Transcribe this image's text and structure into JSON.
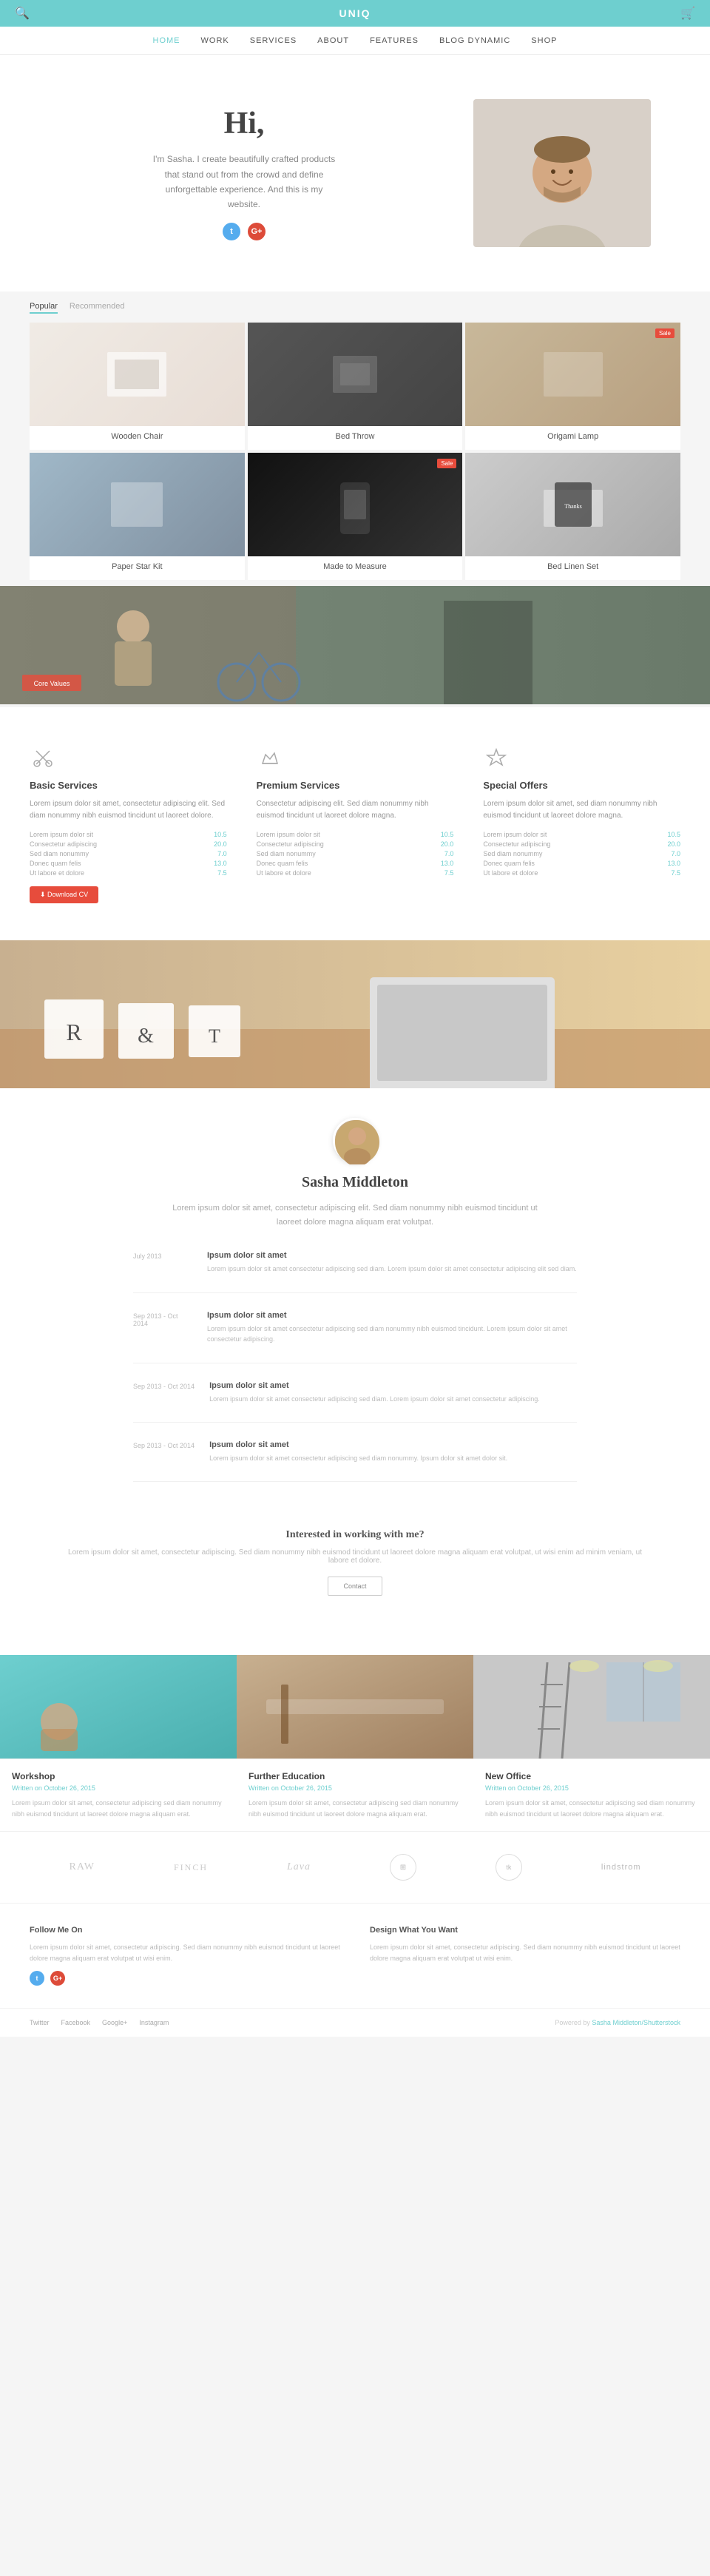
{
  "header": {
    "logo": "UNIQ",
    "search_icon": "🔍",
    "cart_icon": "🛒"
  },
  "nav": {
    "items": [
      {
        "label": "Home",
        "active": true
      },
      {
        "label": "Work",
        "active": false
      },
      {
        "label": "Services",
        "active": false
      },
      {
        "label": "About",
        "active": false
      },
      {
        "label": "Features",
        "active": false
      },
      {
        "label": "Blog Dynamic",
        "active": false
      },
      {
        "label": "Shop",
        "active": false
      }
    ]
  },
  "hero": {
    "greeting": "Hi,",
    "intro": "I'm Sasha. I create beautifully crafted products that stand out from the crowd and define unforgettable experience. And this is my website."
  },
  "portfolio": {
    "tabs": [
      "Popular",
      "Recommended"
    ],
    "items": [
      {
        "label": "Wooden Chair",
        "badge": ""
      },
      {
        "label": "Bed Throw",
        "badge": ""
      },
      {
        "label": "Origami Lamp",
        "badge": "Sale"
      },
      {
        "label": "Paper Star Kit",
        "badge": ""
      },
      {
        "label": "Made to Measure",
        "badge": "Sale"
      },
      {
        "label": "Bed Linen Set",
        "badge": ""
      }
    ]
  },
  "services": {
    "cols": [
      {
        "icon": "✂",
        "title": "Basic Services",
        "desc": "Lorem ipsum dolor sit amet, consectetur adipiscing elit. Sed diam nonummy nibh euismod tincidunt ut laoreet dolore.",
        "items": [
          {
            "label": "Lorem ipsum dolor sit",
            "value": "10.5"
          },
          {
            "label": "Consectetur adipiscing",
            "value": "20.0"
          },
          {
            "label": "Sed diam nonummy",
            "value": "7.0"
          },
          {
            "label": "Donec quam felis",
            "value": "13.0"
          },
          {
            "label": "Ut labore et dolore",
            "value": "7.5"
          }
        ]
      },
      {
        "icon": "♛",
        "title": "Premium Services",
        "desc": "Consectetur adipiscing elit. Sed diam nonummy nibh euismod tincidunt ut laoreet dolore magna.",
        "items": [
          {
            "label": "Lorem ipsum dolor sit",
            "value": "10.5"
          },
          {
            "label": "Consectetur adipiscing",
            "value": "20.0"
          },
          {
            "label": "Sed diam nonummy",
            "value": "7.0"
          },
          {
            "label": "Donec quam felis",
            "value": "13.0"
          },
          {
            "label": "Ut labore et dolore",
            "value": "7.5"
          }
        ]
      },
      {
        "icon": "✦",
        "title": "Special Offers",
        "desc": "Lorem ipsum dolor sit amet, sed diam nonummy nibh euismod tincidunt ut laoreet dolore magna.",
        "items": [
          {
            "label": "Lorem ipsum dolor sit",
            "value": "10.5"
          },
          {
            "label": "Consectetur adipiscing",
            "value": "20.0"
          },
          {
            "label": "Sed diam nonummy",
            "value": "7.0"
          },
          {
            "label": "Donec quam felis",
            "value": "13.0"
          },
          {
            "label": "Ut labore et dolore",
            "value": "7.5"
          }
        ]
      }
    ],
    "download_label": "⬇ Download CV"
  },
  "profile": {
    "name": "Sasha Middleton",
    "bio": "Lorem ipsum dolor sit amet, consectetur adipiscing elit. Sed diam nonummy nibh euismod tincidunt ut laoreet dolore magna aliquam erat volutpat.",
    "timeline": [
      {
        "date": "July 2013",
        "title": "Ipsum dolor sit amet",
        "desc": "Lorem ipsum dolor sit amet consectetur adipiscing sed diam. Lorem ipsum dolor sit amet consectetur adipiscing elit sed diam."
      },
      {
        "date": "Sep 2013 - Oct 2014",
        "title": "Ipsum dolor sit amet",
        "desc": "Lorem ipsum dolor sit amet consectetur adipiscing sed diam nonummy nibh euismod tincidunt. Lorem ipsum dolor sit amet consectetur adipiscing."
      },
      {
        "date": "Sep 2013 - Oct 2014",
        "title": "Ipsum dolor sit amet",
        "desc": "Lorem ipsum dolor sit amet consectetur adipiscing sed diam. Lorem ipsum dolor sit amet consectetur adipiscing."
      },
      {
        "date": "Sep 2013 - Oct 2014",
        "title": "Ipsum dolor sit amet",
        "desc": "Lorem ipsum dolor sit amet consectetur adipiscing sed diam nonummy. Ipsum dolor sit amet dolor sit."
      }
    ],
    "cta_title": "Interested in working with me?",
    "cta_desc": "Lorem ipsum dolor sit amet, consectetur adipiscing. Sed diam nonummy nibh euismod tincidunt ut laoreet dolore magna aliquam erat volutpat, ut wisi enim ad minim veniam, ut labore et dolore.",
    "contact_label": "Contact"
  },
  "cards": [
    {
      "title": "Workshop",
      "date": "Written on October 26, 2015",
      "desc": "Lorem ipsum dolor sit amet, consectetur adipiscing sed diam nonummy nibh euismod tincidunt ut laoreet dolore magna aliquam erat.",
      "color": "workshop"
    },
    {
      "title": "Further Education",
      "date": "Written on October 26, 2015",
      "desc": "Lorem ipsum dolor sit amet, consectetur adipiscing sed diam nonummy nibh euismod tincidunt ut laoreet dolore magna aliquam erat.",
      "color": "education"
    },
    {
      "title": "New Office",
      "date": "Written on October 26, 2015",
      "desc": "Lorem ipsum dolor sit amet, consectetur adipiscing sed diam nonummy nibh euismod tincidunt ut laoreet dolore magna aliquam erat.",
      "color": "office"
    }
  ],
  "brands": [
    {
      "type": "text",
      "label": "RAW"
    },
    {
      "type": "text",
      "label": "FINCH"
    },
    {
      "type": "text",
      "label": "Lava"
    },
    {
      "type": "icon",
      "label": "⊞"
    },
    {
      "type": "icon-circle",
      "label": "tk"
    },
    {
      "type": "text",
      "label": "lindstrom"
    }
  ],
  "footer": {
    "follow_title": "Follow Me On",
    "follow_text": "Lorem ipsum dolor sit amet, consectetur adipiscing. Sed diam nonummy nibh euismod tincidunt ut laoreet dolore magna aliquam erat volutpat ut wisi enim.",
    "design_title": "Design What You Want",
    "design_text": "Lorem ipsum dolor sit amet, consectetur adipiscing. Sed diam nonummy nibh euismod tincidunt ut laoreet dolore magna aliquam erat volutpat ut wisi enim.",
    "nav_links": [
      "Twitter",
      "Facebook",
      "Google+",
      "Instagram"
    ],
    "copyright": "Powered by Sasha Middleton/Shutterstock"
  }
}
